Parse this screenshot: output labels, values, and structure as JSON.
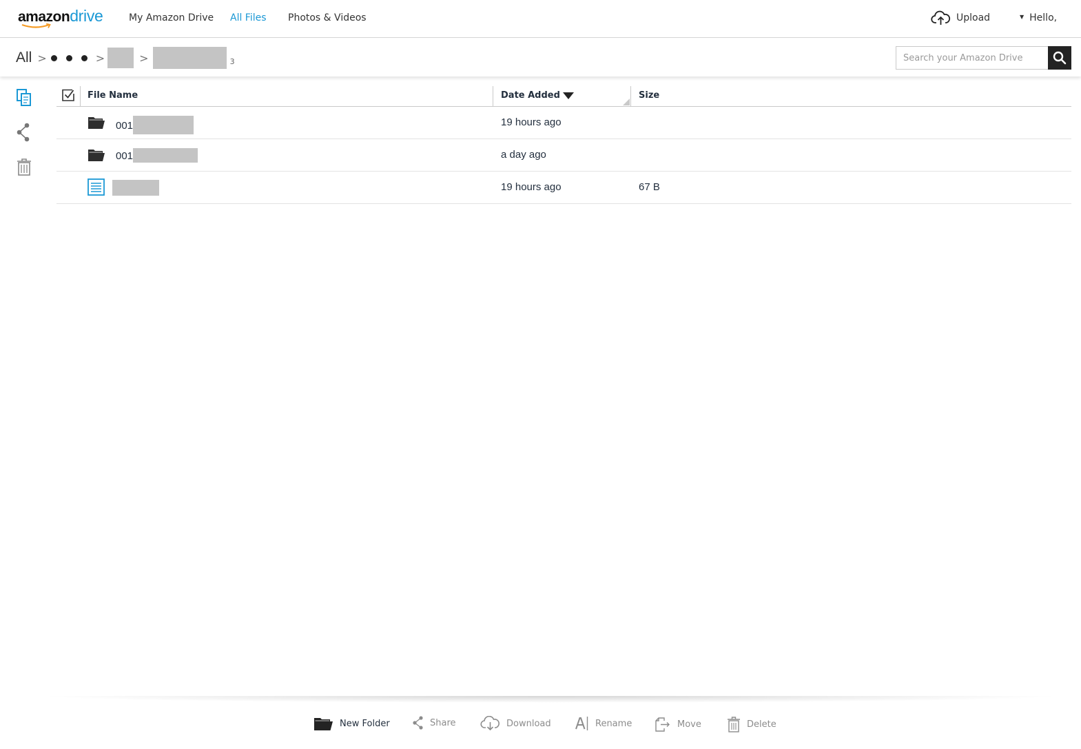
{
  "header": {
    "logo_part1": "amazon",
    "logo_part2": "drive",
    "nav": [
      {
        "label": "My Amazon Drive",
        "active": false
      },
      {
        "label": "All Files",
        "active": true
      },
      {
        "label": "Photos & Videos",
        "active": false
      }
    ],
    "upload_label": "Upload",
    "greeting": "Hello,",
    "accent_color": "#1a98d5"
  },
  "breadcrumb": {
    "root": "All",
    "count": "3"
  },
  "search": {
    "placeholder": "Search your Amazon Drive"
  },
  "sidebar": {
    "icons": [
      "copy-icon",
      "share-icon",
      "trash-icon"
    ]
  },
  "table": {
    "columns": {
      "name": "File Name",
      "date": "Date Added",
      "size": "Size"
    },
    "sort": "date-descending",
    "rows": [
      {
        "type": "folder",
        "name_prefix": "001",
        "date": "19 hours ago",
        "size": ""
      },
      {
        "type": "folder",
        "name_prefix": "001",
        "date": "a day ago",
        "size": ""
      },
      {
        "type": "document",
        "name_prefix": "",
        "date": "19 hours ago",
        "size": "67 B"
      }
    ]
  },
  "toolbar": {
    "new_folder": "New Folder",
    "share": "Share",
    "download": "Download",
    "rename": "Rename",
    "move": "Move",
    "delete": "Delete"
  }
}
